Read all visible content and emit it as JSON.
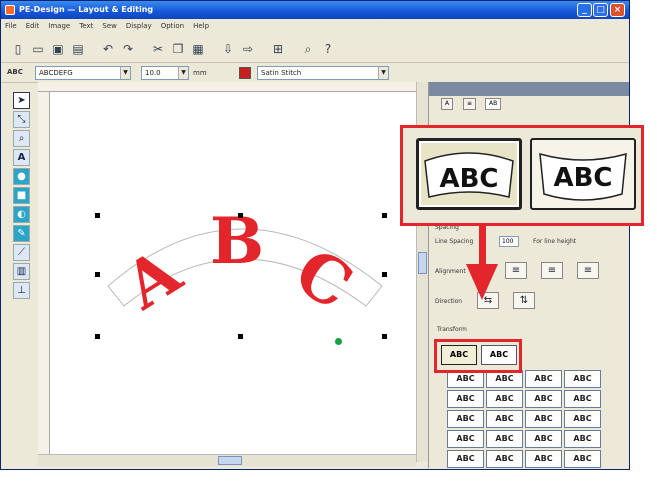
{
  "window": {
    "title": "PE-Design — Layout & Editing"
  },
  "menu": [
    "File",
    "Edit",
    "Image",
    "Text",
    "Sew",
    "Display",
    "Option",
    "Help"
  ],
  "toolbar": {
    "icons": [
      "new-icon",
      "open-icon",
      "save-icon",
      "print-icon",
      "undo-icon",
      "redo-icon",
      "cut-icon",
      "copy-icon",
      "paste-icon",
      "import-icon",
      "send-icon",
      "grid-icon",
      "zoom-icon",
      "help-icon"
    ]
  },
  "formatbar": {
    "text_value": "ABC",
    "font_name": "ABCDEFG",
    "size": "10.0",
    "unit": "mm",
    "sew_type": "Satin Stitch"
  },
  "tools": [
    "select-icon",
    "point-edit-icon",
    "zoom-icon",
    "text-icon",
    "shape-circle-icon",
    "shape-rect-icon",
    "outline-icon",
    "brush-icon",
    "measure-icon",
    "pattern-icon",
    "stitch-icon"
  ],
  "canvas": {
    "text": "ABC",
    "text_color": "#e3262b"
  },
  "panel": {
    "tabs": [
      "A",
      "≡",
      "AB"
    ],
    "fields": {
      "spacing_label": "Spacing",
      "line_spacing_label": "Line Spacing",
      "line_spacing_value": "100",
      "for_line_height_label": "For line height",
      "alignment_label": "Alignment",
      "direction_label": "Direction",
      "transform_label": "Transform"
    },
    "transform_grid": [
      "ABC",
      "ABC",
      "ABC",
      "ABC",
      "ABC",
      "ABC",
      "ABC",
      "ABC",
      "ABC",
      "ABC",
      "ABC",
      "ABC",
      "ABC",
      "ABC",
      "ABC",
      "ABC",
      "ABC",
      "ABC",
      "ABC",
      "ABC"
    ]
  },
  "callout": {
    "thumb_1": "ABC",
    "thumb_2": "ABC",
    "accent": "#e3262b"
  }
}
